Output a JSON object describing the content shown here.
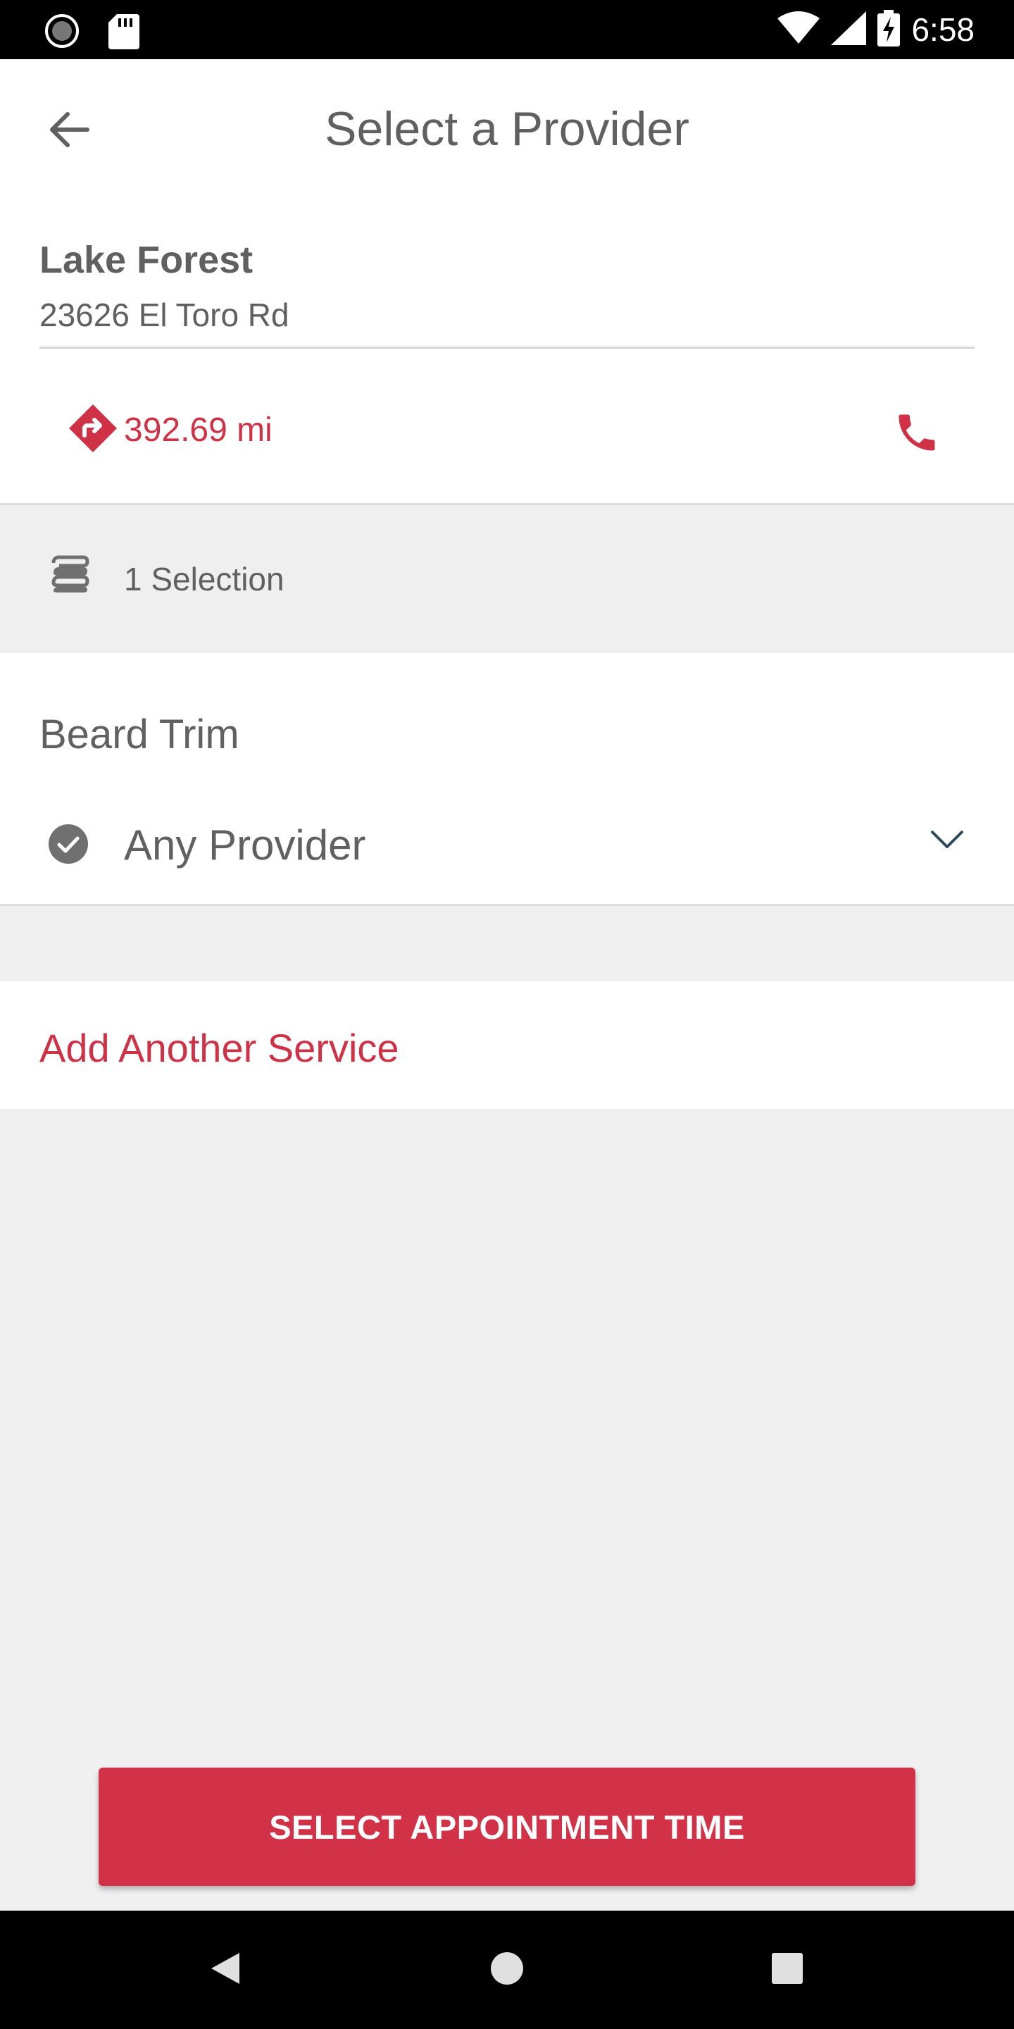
{
  "status_bar": {
    "time": "6:58",
    "icons": [
      "sync-icon",
      "sd-card-icon",
      "wifi-icon",
      "signal-icon",
      "battery-charging-icon"
    ]
  },
  "app_bar": {
    "title": "Select a Provider",
    "back_icon": "arrow-left-icon"
  },
  "location": {
    "name": "Lake Forest",
    "address": "23626 El Toro Rd",
    "distance": "392.69 mi",
    "directions_icon": "directions-icon",
    "phone_icon": "phone-icon"
  },
  "selection": {
    "icon": "stack-icon",
    "label": "1 Selection"
  },
  "service": {
    "name": "Beard Trim",
    "provider": "Any Provider",
    "check_icon": "check-circle-icon",
    "expand_icon": "chevron-down-icon"
  },
  "add_service": {
    "label": "Add Another Service"
  },
  "cta": {
    "label": "SELECT APPOINTMENT TIME"
  },
  "colors": {
    "accent": "#d23247",
    "text": "#606060",
    "background": "#f0f0f0"
  }
}
